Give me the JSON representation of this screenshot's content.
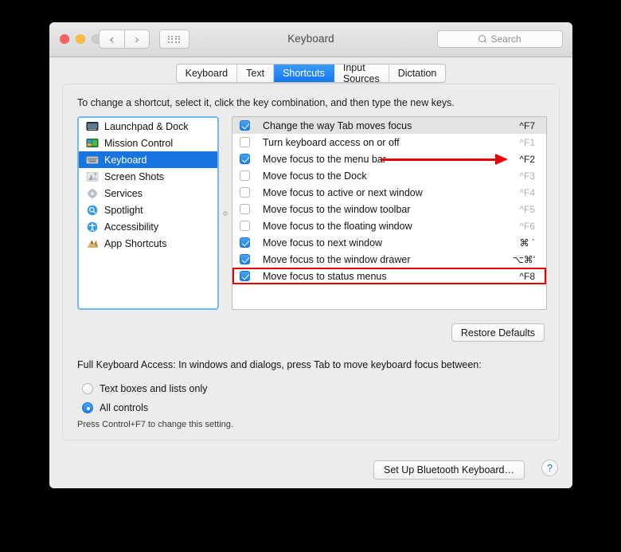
{
  "window": {
    "title": "Keyboard",
    "traffic": {
      "close": "close-button",
      "minimize": "minimize-button",
      "zoom": "zoom-button"
    },
    "nav": {
      "back": "‹",
      "forward": "›",
      "grid": "show-all-icon"
    },
    "search": {
      "placeholder": "Search",
      "value": ""
    }
  },
  "tabs": [
    {
      "label": "Keyboard",
      "active": false
    },
    {
      "label": "Text",
      "active": false
    },
    {
      "label": "Shortcuts",
      "active": true
    },
    {
      "label": "Input Sources",
      "active": false
    },
    {
      "label": "Dictation",
      "active": false
    }
  ],
  "hint": "To change a shortcut, select it, click the key combination, and then type the new keys.",
  "sidebar": {
    "items": [
      {
        "label": "Launchpad & Dock",
        "icon": "launchpad-dock-icon",
        "selected": false
      },
      {
        "label": "Mission Control",
        "icon": "mission-control-icon",
        "selected": false
      },
      {
        "label": "Keyboard",
        "icon": "keyboard-icon",
        "selected": true
      },
      {
        "label": "Screen Shots",
        "icon": "screen-shots-icon",
        "selected": false
      },
      {
        "label": "Services",
        "icon": "services-gear-icon",
        "selected": false
      },
      {
        "label": "Spotlight",
        "icon": "spotlight-search-icon",
        "selected": false
      },
      {
        "label": "Accessibility",
        "icon": "accessibility-icon",
        "selected": false
      },
      {
        "label": "App Shortcuts",
        "icon": "app-shortcuts-icon",
        "selected": false
      }
    ]
  },
  "shortcuts": [
    {
      "label": "Change the way Tab moves focus",
      "key": "^F7",
      "checked": true,
      "dim": false,
      "selected": true,
      "arrow": false,
      "highlight": false
    },
    {
      "label": "Turn keyboard access on or off",
      "key": "^F1",
      "checked": false,
      "dim": true,
      "selected": false,
      "arrow": false,
      "highlight": false
    },
    {
      "label": "Move focus to the menu bar",
      "key": "^F2",
      "checked": true,
      "dim": false,
      "selected": false,
      "arrow": true,
      "highlight": false
    },
    {
      "label": "Move focus to the Dock",
      "key": "^F3",
      "checked": false,
      "dim": true,
      "selected": false,
      "arrow": false,
      "highlight": false
    },
    {
      "label": "Move focus to active or next window",
      "key": "^F4",
      "checked": false,
      "dim": true,
      "selected": false,
      "arrow": false,
      "highlight": false
    },
    {
      "label": "Move focus to the window toolbar",
      "key": "^F5",
      "checked": false,
      "dim": true,
      "selected": false,
      "arrow": false,
      "highlight": false
    },
    {
      "label": "Move focus to the floating window",
      "key": "^F6",
      "checked": false,
      "dim": true,
      "selected": false,
      "arrow": false,
      "highlight": false
    },
    {
      "label": "Move focus to next window",
      "key": "⌘ `",
      "checked": true,
      "dim": false,
      "selected": false,
      "arrow": false,
      "highlight": false
    },
    {
      "label": "Move focus to the window drawer",
      "key": "⌥⌘'",
      "checked": true,
      "dim": false,
      "selected": false,
      "arrow": false,
      "highlight": false
    },
    {
      "label": "Move focus to status menus",
      "key": "^F8",
      "checked": true,
      "dim": false,
      "selected": false,
      "arrow": false,
      "highlight": true
    }
  ],
  "restore_defaults_label": "Restore Defaults",
  "full_keyboard_access": {
    "description": "Full Keyboard Access: In windows and dialogs, press Tab to move keyboard focus between:",
    "options": [
      {
        "label": "Text boxes and lists only",
        "selected": false
      },
      {
        "label": "All controls",
        "selected": true
      }
    ],
    "note": "Press Control+F7 to change this setting."
  },
  "footer": {
    "bluetooth_label": "Set Up Bluetooth Keyboard…",
    "help_label": "?"
  },
  "colors": {
    "accent_blue": "#1675e0",
    "annotation_red": "#e80000",
    "selection_grey": "#e3e3e3",
    "panel_bg": "#ececec"
  }
}
